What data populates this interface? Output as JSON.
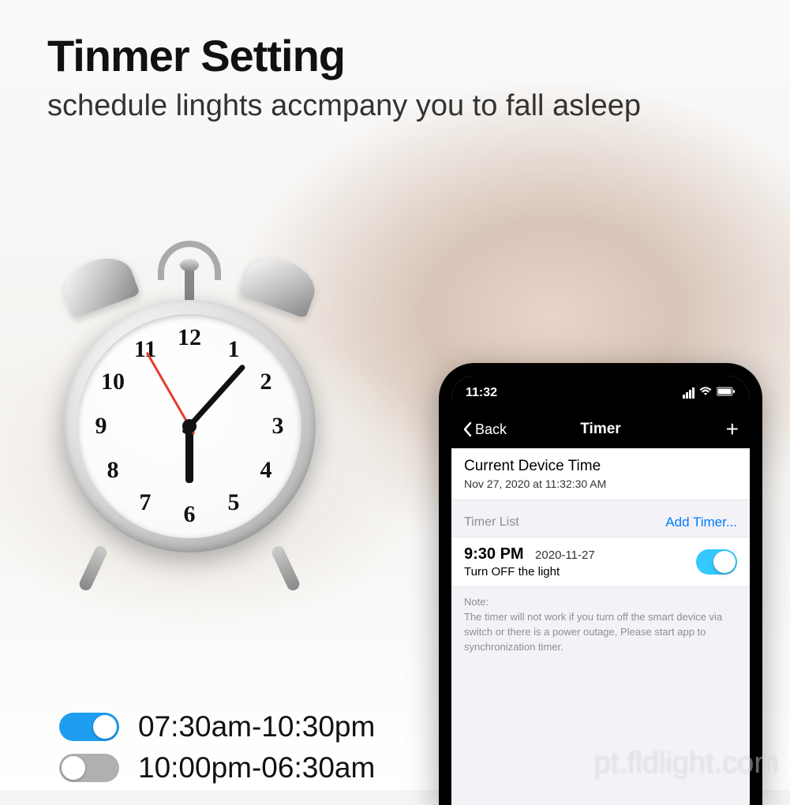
{
  "heading": {
    "title": "Tinmer Setting",
    "subtitle": "schedule linghts accmpany you to fall asleep"
  },
  "schedules": [
    {
      "on": true,
      "range": "07:30am-10:30pm"
    },
    {
      "on": false,
      "range": "10:00pm-06:30am"
    }
  ],
  "phone": {
    "status": {
      "time": "11:32"
    },
    "nav": {
      "back": "Back",
      "title": "Timer",
      "plus": "+"
    },
    "current": {
      "label": "Current Device Time",
      "value": "Nov 27, 2020 at 11:32:30 AM"
    },
    "timerList": {
      "header": "Timer List",
      "addLabel": "Add Timer..."
    },
    "timer": {
      "time": "9:30 PM",
      "date": "2020-11-27",
      "action": "Turn OFF the light",
      "enabled": true
    },
    "note": {
      "label": "Note:",
      "text": "The timer will not work if you turn off the smart device via switch or there is a power outage, Please start app to synchronization timer."
    }
  },
  "clock": {
    "numerals": [
      "12",
      "1",
      "2",
      "3",
      "4",
      "5",
      "6",
      "7",
      "8",
      "9",
      "10",
      "11"
    ]
  },
  "watermark": "pt.fldlight.com"
}
